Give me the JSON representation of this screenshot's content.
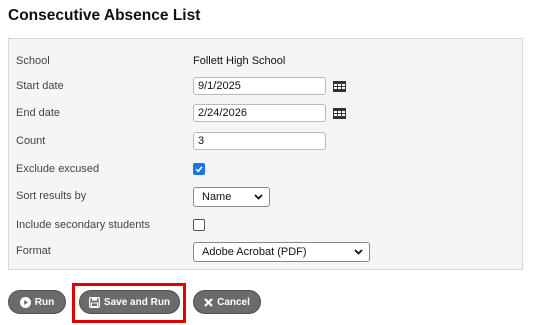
{
  "title": "Consecutive Absence List",
  "form": {
    "school": {
      "label": "School",
      "value": "Follett High School"
    },
    "start_date": {
      "label": "Start date",
      "value": "9/1/2025"
    },
    "end_date": {
      "label": "End date",
      "value": "2/24/2026"
    },
    "count": {
      "label": "Count",
      "value": "3"
    },
    "exclude_excused": {
      "label": "Exclude excused",
      "checked": true
    },
    "sort_results_by": {
      "label": "Sort results by",
      "value": "Name"
    },
    "include_secondary": {
      "label": "Include secondary students",
      "checked": false
    },
    "format": {
      "label": "Format",
      "value": "Adobe Acrobat (PDF)"
    }
  },
  "buttons": {
    "run": "Run",
    "save_and_run": "Save and Run",
    "cancel": "Cancel"
  },
  "colors": {
    "button_bg": "#6b6b6b",
    "checkbox_accent": "#1a73e8",
    "highlight": "#e00000",
    "panel_bg": "#f5f5f5"
  }
}
